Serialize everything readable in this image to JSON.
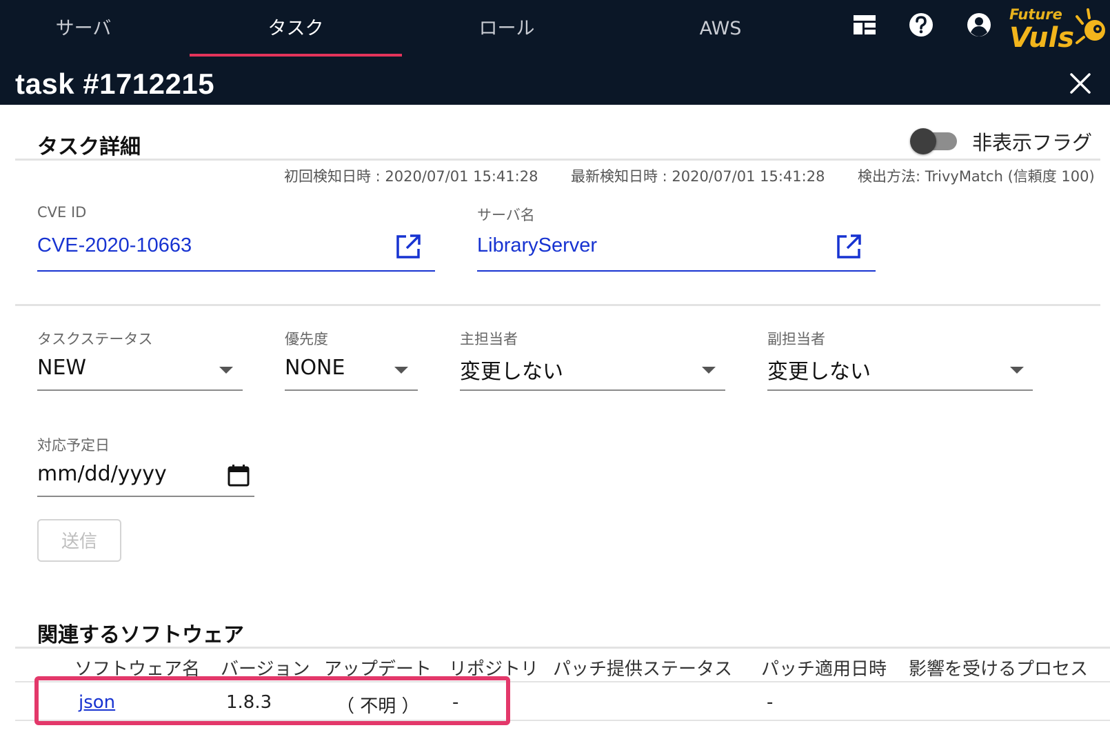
{
  "nav": {
    "tabs": [
      {
        "label": "サーバ",
        "active": false
      },
      {
        "label": "タスク",
        "active": true
      },
      {
        "label": "ロール",
        "active": false
      },
      {
        "label": "AWS",
        "active": false
      }
    ],
    "icons": [
      "dashboard-icon",
      "help-icon",
      "account-icon"
    ],
    "logo_text": "Future Vuls"
  },
  "modal": {
    "title": "task #1712215",
    "close_icon": "close-icon"
  },
  "task_detail": {
    "heading": "タスク詳細",
    "hidden_flag_label": "非表示フラグ",
    "hidden_flag_on": false,
    "first_detected": "初回検知日時 : 2020/07/01 15:41:28",
    "last_detected": "最新検知日時 : 2020/07/01 15:41:28",
    "detection_method": "検出方法: TrivyMatch (信頼度 100)",
    "cve_label": "CVE ID",
    "cve_value": "CVE-2020-10663",
    "server_label": "サーバ名",
    "server_value": "LibraryServer"
  },
  "form": {
    "status_label": "タスクステータス",
    "status_value": "NEW",
    "priority_label": "優先度",
    "priority_value": "NONE",
    "main_assignee_label": "主担当者",
    "main_assignee_value": "変更しない",
    "sub_assignee_label": "副担当者",
    "sub_assignee_value": "変更しない",
    "due_label": "対応予定日",
    "due_value": "mm/dd/yyyy",
    "submit_label": "送信"
  },
  "software": {
    "heading": "関連するソフトウェア",
    "columns": [
      "ソフトウェア名",
      "バージョン",
      "アップデート",
      "リポジトリ",
      "パッチ提供ステータス",
      "パッチ適用日時",
      "影響を受けるプロセス"
    ],
    "rows": [
      {
        "name": "json",
        "version": "1.8.3",
        "update": "（ 不明 ）",
        "repository": "-",
        "patch_status": "",
        "patch_date": "-",
        "process": ""
      }
    ]
  },
  "colors": {
    "header_bg": "#0b1727",
    "accent": "#e3345a",
    "link": "#1733d1"
  }
}
